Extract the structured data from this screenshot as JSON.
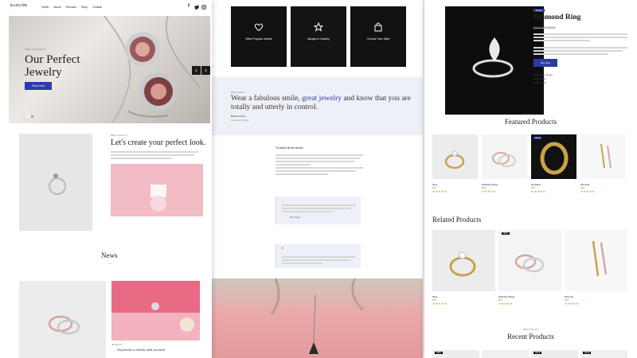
{
  "colors": {
    "accent": "#2e3aa8",
    "gold": "#c8a24a",
    "tint": "#eef0f8",
    "dark": "#111111"
  },
  "page1": {
    "nav": {
      "logo": "JewelryMe",
      "items": [
        "Home",
        "About",
        "Services",
        "Shop",
        "Contact"
      ],
      "social_icons": [
        "facebook-icon",
        "twitter-icon",
        "instagram-icon"
      ]
    },
    "hero": {
      "kicker": "New Collection",
      "title_line1": "Our Perfect",
      "title_line2": "Jewelry",
      "button": "Shop Now",
      "prev_arrow": "‹",
      "next_arrow": "›"
    },
    "feature": {
      "kicker": "BEST QUALITY",
      "title": "Let's create your perfect look."
    },
    "news": {
      "title": "News",
      "divider": "—",
      "post_date": "JEWELRY",
      "post_title": "Our jewelry is exactly what you need"
    }
  },
  "page2": {
    "categories": [
      {
        "label": "Wear Popular Jewels",
        "icon": "heart-icon"
      },
      {
        "label": "Always in Jewelry",
        "icon": "star-icon"
      },
      {
        "label": "Choose Your Style",
        "icon": "shopping-bag-icon"
      }
    ],
    "quote": {
      "kicker": "BEST DEALS",
      "text_start": "Wear a fabulous smile, ",
      "text_highlight": "great jewelry",
      "text_end": " and know that you are totally and utterly in control.",
      "author": "Bertha Torres",
      "role": "Company Owner"
    },
    "article_heading": "To follow all the trends",
    "testimonial_author": "Mia Taylor",
    "quote_mark": "❝"
  },
  "page3": {
    "product": {
      "badge": "SALE",
      "title": "Diamond Ring",
      "price_old": "$150.00",
      "price_new": "$ 139.00",
      "button": "Buy Now",
      "meta_category": "Categories: Rings",
      "meta_tags": "Tags: Rings",
      "meta_reviews": "Reviews (0)"
    },
    "featured": {
      "kicker": "BEST DEALS",
      "title": "Featured Products",
      "items": [
        {
          "name": "Ring",
          "price": "$99",
          "stars": "★★★★★"
        },
        {
          "name": "Wedding Rings",
          "price": "$69",
          "stars": "★★★★★"
        },
        {
          "name": "Necklace",
          "price": "$85",
          "stars": "★★★★★",
          "badge": "SALE"
        },
        {
          "name": "Earrings",
          "price": "$49",
          "stars": "★★★★★"
        }
      ]
    },
    "related": {
      "title": "Related Products",
      "items": [
        {
          "name": "Ring",
          "price": "$99",
          "stars": "★★★★★"
        },
        {
          "name": "Wedding Rings",
          "price": "$69",
          "stars": "★★★★★",
          "badge": "NEW"
        },
        {
          "name": "Earrings",
          "price": "$49",
          "stars": "★★★★★"
        }
      ]
    },
    "recent": {
      "kicker": "BEST DEALS",
      "title": "Recent Products",
      "badges": [
        "NEW",
        "SALE",
        "SALE"
      ]
    }
  }
}
